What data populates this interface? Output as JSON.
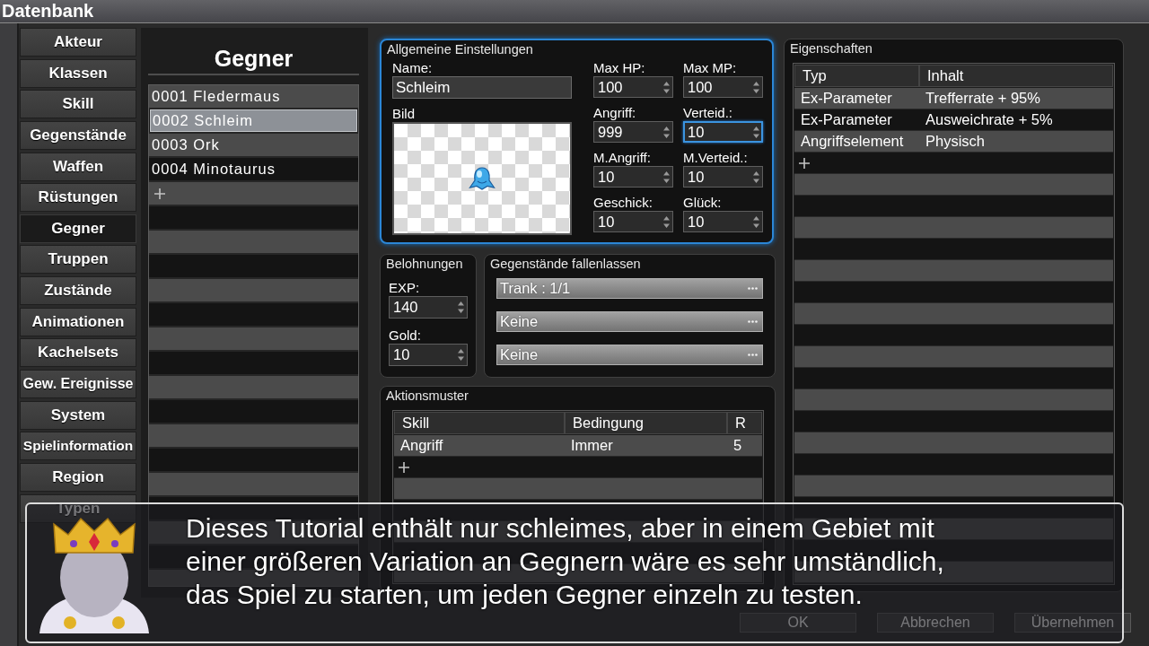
{
  "window": {
    "title": "Datenbank"
  },
  "sidebar": {
    "items": [
      {
        "label": "Akteur",
        "selected": false
      },
      {
        "label": "Klassen",
        "selected": false
      },
      {
        "label": "Skill",
        "selected": false
      },
      {
        "label": "Gegenstände",
        "selected": false
      },
      {
        "label": "Waffen",
        "selected": false
      },
      {
        "label": "Rüstungen",
        "selected": false
      },
      {
        "label": "Gegner",
        "selected": true
      },
      {
        "label": "Truppen",
        "selected": false
      },
      {
        "label": "Zustände",
        "selected": false
      },
      {
        "label": "Animationen",
        "selected": false
      },
      {
        "label": "Kachelsets",
        "selected": false
      },
      {
        "label": "Gew. Ereignisse",
        "selected": false
      },
      {
        "label": "System",
        "selected": false
      },
      {
        "label": "Spielinformation",
        "selected": false
      },
      {
        "label": "Region",
        "selected": false
      },
      {
        "label": "Typen",
        "selected": false
      }
    ]
  },
  "enemies": {
    "title": "Gegner",
    "items": [
      {
        "label": "0001 Fledermaus",
        "selected": false
      },
      {
        "label": "0002 Schleim",
        "selected": true
      },
      {
        "label": "0003 Ork",
        "selected": false
      },
      {
        "label": "0004 Minotaurus",
        "selected": false
      }
    ]
  },
  "general": {
    "title": "Allgemeine Einstellungen",
    "focused": true,
    "name": {
      "label": "Name:",
      "value": "Schleim"
    },
    "image": {
      "label": "Bild"
    },
    "stats": [
      {
        "label": "Max HP:",
        "value": "100",
        "focused": false
      },
      {
        "label": "Max MP:",
        "value": "100",
        "focused": false
      },
      {
        "label": "Angriff:",
        "value": "999",
        "focused": false
      },
      {
        "label": "Verteid.:",
        "value": "10",
        "focused": true
      },
      {
        "label": "M.Angriff:",
        "value": "10",
        "focused": false
      },
      {
        "label": "M.Verteid.:",
        "value": "10",
        "focused": false
      },
      {
        "label": "Geschick:",
        "value": "10",
        "focused": false
      },
      {
        "label": "Glück:",
        "value": "10",
        "focused": false
      }
    ]
  },
  "rewards": {
    "title": "Belohnungen",
    "fields": [
      {
        "label": "EXP:",
        "value": "140"
      },
      {
        "label": "Gold:",
        "value": "10"
      }
    ]
  },
  "drops": {
    "title": "Gegenstände fallenlassen",
    "items": [
      "Trank : 1/1",
      "Keine",
      "Keine"
    ]
  },
  "actions": {
    "title": "Aktionsmuster",
    "table": {
      "columns": [
        "Skill",
        "Bedingung",
        "R"
      ],
      "rows": [
        [
          "Angriff",
          "Immer",
          "5"
        ]
      ]
    }
  },
  "traits": {
    "title": "Eigenschaften",
    "table": {
      "columns": [
        "Typ",
        "Inhalt"
      ],
      "rows": [
        [
          "Ex-Parameter",
          "Trefferrate + 95%"
        ],
        [
          "Ex-Parameter",
          "Ausweichrate + 5%"
        ],
        [
          "Angriffselement",
          "Physisch"
        ]
      ]
    }
  },
  "buttons": [
    "OK",
    "Abbrechen",
    "Übernehmen"
  ],
  "message": {
    "lines": [
      "Dieses Tutorial enthält nur schleimes, aber in einem Gebiet mit",
      "einer größeren Variation an Gegnern wäre es sehr umständlich,",
      "das Spiel zu starten, um jeden Gegner einzeln zu testen."
    ]
  }
}
